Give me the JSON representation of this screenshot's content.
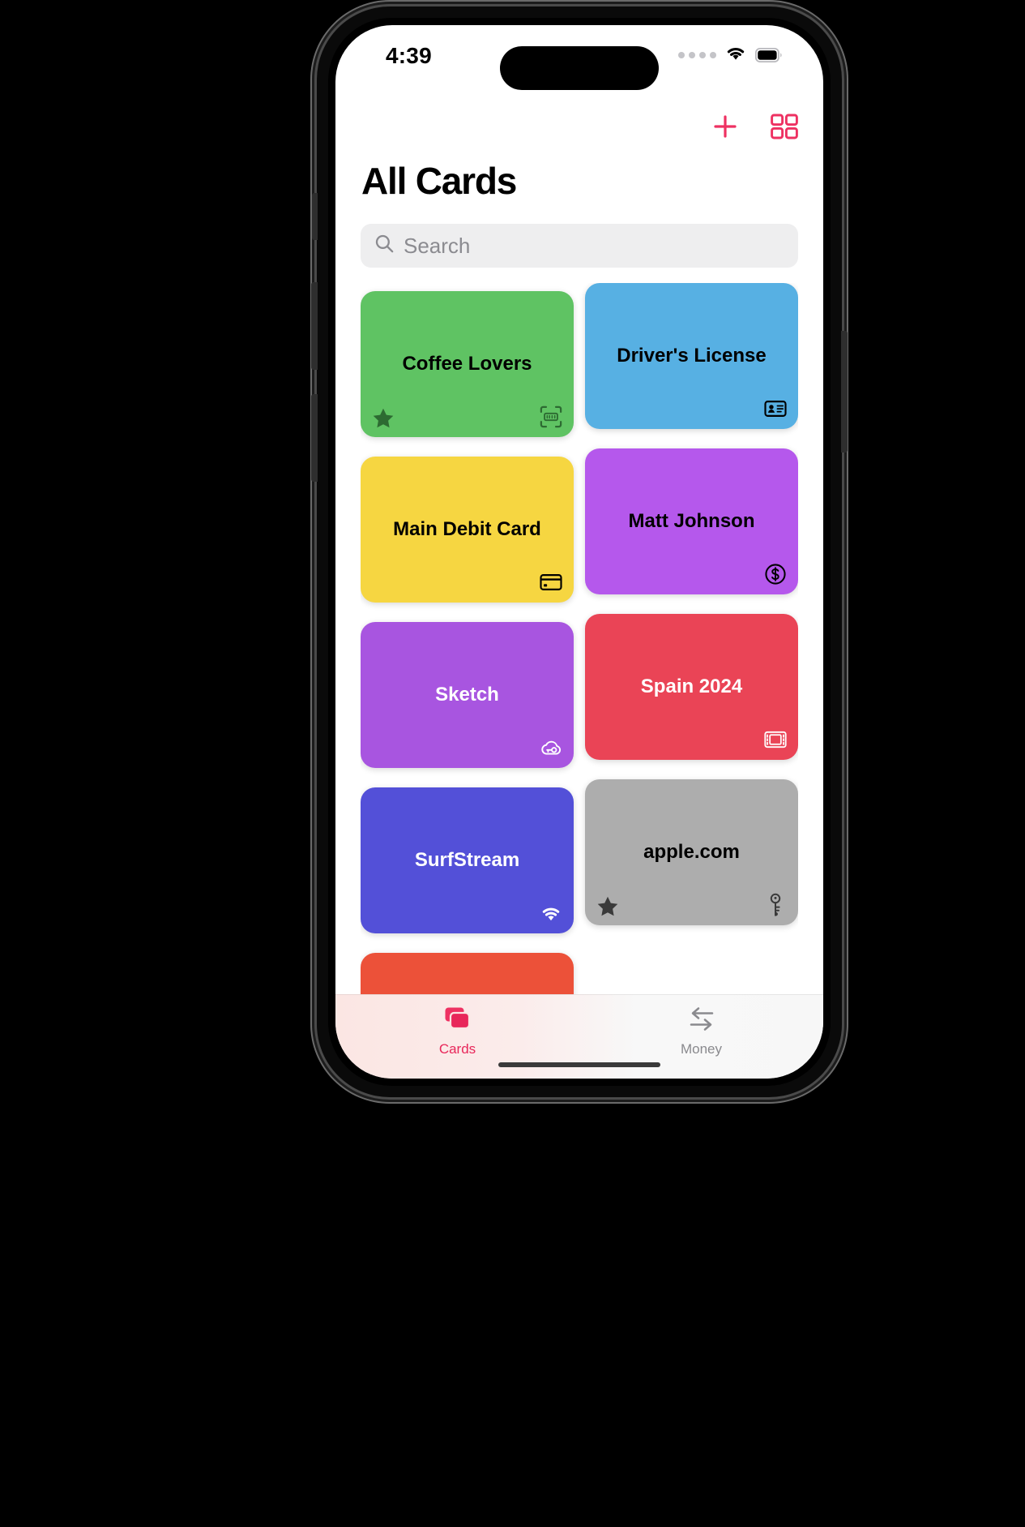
{
  "status_bar": {
    "time": "4:39",
    "cellular_icon": "cellular-dots-icon",
    "wifi_icon": "wifi-icon",
    "battery_icon": "battery-icon"
  },
  "nav": {
    "add_icon": "plus-icon",
    "add_label": "+",
    "grid_icon": "grid-view-icon",
    "accent": "#ee3162"
  },
  "header": {
    "title": "All Cards"
  },
  "search": {
    "placeholder": "Search",
    "value": "",
    "icon": "search-icon"
  },
  "cards": [
    {
      "title": "Coffee Lovers",
      "bg": "#5FC363",
      "text_color": "#000000",
      "favorite": true,
      "type_icon": "barcode-scan-icon",
      "icon_color": "#2d6b32"
    },
    {
      "title": "Driver's License",
      "bg": "#57B0E3",
      "text_color": "#000000",
      "favorite": false,
      "type_icon": "id-card-icon",
      "icon_color": "#000000"
    },
    {
      "title": "Main Debit Card",
      "bg": "#F6D641",
      "text_color": "#000000",
      "favorite": false,
      "type_icon": "credit-card-icon",
      "icon_color": "#000000"
    },
    {
      "title": "Matt Johnson",
      "bg": "#B martial",
      "text_color": "#000000",
      "favorite": false,
      "type_icon": "dollar-circle-icon",
      "icon_color": "#000000"
    },
    {
      "title": "Sketch",
      "bg": "#A855E0",
      "text_color": "#ffffff",
      "favorite": false,
      "type_icon": "cloud-key-icon",
      "icon_color": "#ffffff"
    },
    {
      "title": "Spain 2024",
      "bg": "#EA4456",
      "text_color": "#ffffff",
      "favorite": false,
      "type_icon": "film-strip-icon",
      "icon_color": "#ffffff"
    },
    {
      "title": "SurfStream",
      "bg": "#5350D8",
      "text_color": "#ffffff",
      "favorite": false,
      "type_icon": "wifi-icon",
      "icon_color": "#ffffff"
    },
    {
      "title": "apple.com",
      "bg": "#ADADAD",
      "text_color": "#000000",
      "favorite": true,
      "type_icon": "key-icon",
      "icon_color": "#3a3a3a"
    },
    {
      "title": "",
      "bg": "#EC5139",
      "text_color": "#ffffff",
      "favorite": false,
      "type_icon": "",
      "icon_color": "#ffffff"
    }
  ],
  "tabs": [
    {
      "label": "Cards",
      "icon": "stacked-cards-icon",
      "active": true,
      "color": "#ee3162"
    },
    {
      "label": "Money",
      "icon": "transfer-arrows-icon",
      "active": false,
      "color": "#8a8a8e"
    }
  ]
}
